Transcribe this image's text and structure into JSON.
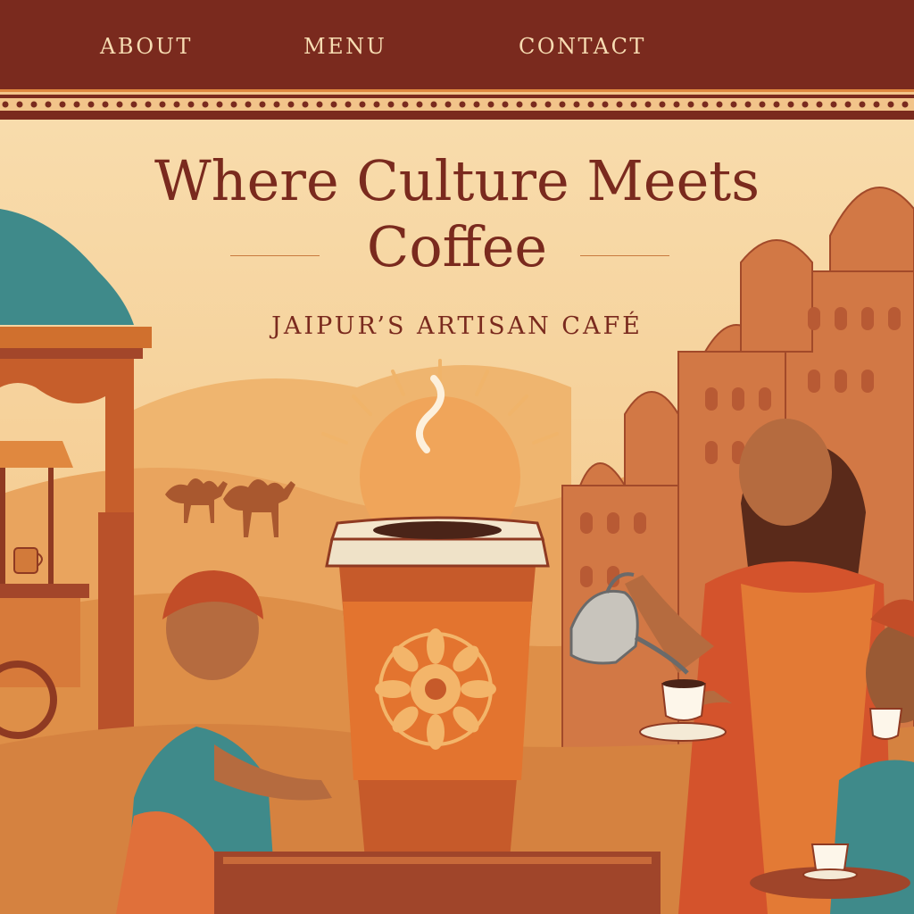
{
  "nav": {
    "items": [
      {
        "label": "ABOUT"
      },
      {
        "label": "MENU"
      },
      {
        "label": "CONTACT"
      }
    ]
  },
  "hero": {
    "title_line1": "Where Culture Meets",
    "title_line2": "Coffee",
    "subtitle": "JAIPUR’S ARTISAN CAFÉ"
  },
  "colors": {
    "nav_bg": "#7a2a1e",
    "nav_text": "#f7dcb2",
    "heading": "#7a2a1e",
    "background": "#f6d7a4",
    "accent_orange": "#e07a2f"
  },
  "icons": [
    "camel-icon",
    "coffee-cup-icon",
    "teacup-icon",
    "kettle-icon",
    "sun-icon",
    "palace-icon",
    "mandala-icon"
  ]
}
